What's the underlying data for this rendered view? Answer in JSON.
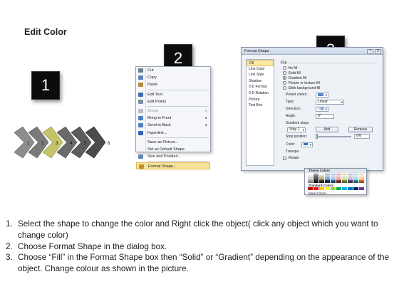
{
  "title": "Edit Color",
  "step_badges": [
    "1",
    "2",
    "3"
  ],
  "diagram": {
    "labels": [
      "1",
      "2",
      "3",
      "4",
      "5",
      "6"
    ],
    "colors": {
      "gray": "#8c8c8c",
      "selected": "#c6c46a",
      "dark": "#4c4c4c"
    }
  },
  "context_menu": {
    "items": [
      {
        "label": "Cut",
        "icon": "scissors-icon",
        "color": "#6b7c93",
        "state": "normal",
        "submenu": false
      },
      {
        "label": "Copy",
        "icon": "copy-icon",
        "color": "#5a83b8",
        "state": "normal",
        "submenu": false
      },
      {
        "label": "Paste",
        "icon": "paste-icon",
        "color": "#b8893a",
        "state": "normal",
        "submenu": false
      },
      {
        "label": "Edit Text",
        "icon": "edit-text-icon",
        "color": "#3d6fb0",
        "state": "normal",
        "submenu": false
      },
      {
        "label": "Edit Points",
        "icon": "edit-points-icon",
        "color": "#7a8ca3",
        "state": "normal",
        "submenu": false
      },
      {
        "label": "Group",
        "icon": "group-icon",
        "color": "#b8bec8",
        "state": "disabled",
        "submenu": true
      },
      {
        "label": "Bring to Front",
        "icon": "bring-to-front-icon",
        "color": "#4f7fc0",
        "state": "normal",
        "submenu": true
      },
      {
        "label": "Send to Back",
        "icon": "send-to-back-icon",
        "color": "#4f7fc0",
        "state": "normal",
        "submenu": true
      },
      {
        "label": "Hyperlink...",
        "icon": "hyperlink-icon",
        "color": "#2f66b3",
        "state": "normal",
        "submenu": false
      },
      {
        "label": "Save as Picture...",
        "icon": "",
        "color": "",
        "state": "normal",
        "submenu": false
      },
      {
        "label": "Set as Default Shape",
        "icon": "",
        "color": "",
        "state": "normal",
        "submenu": false
      },
      {
        "label": "Size and Position...",
        "icon": "size-position-icon",
        "color": "#5d87bd",
        "state": "normal",
        "submenu": false
      },
      {
        "label": "Format Shape...",
        "icon": "format-shape-icon",
        "color": "#c78a2e",
        "state": "highlight",
        "submenu": false
      }
    ]
  },
  "dialog": {
    "title": "Format Shape",
    "controls": [
      "?",
      "X"
    ],
    "nav": [
      "Fill",
      "Line Color",
      "Line Style",
      "Shadow",
      "3-D Format",
      "3-D Rotation",
      "Picture",
      "Text Box"
    ],
    "active_nav": "Fill",
    "section_title": "Fill",
    "fill_options": [
      {
        "label": "No fill",
        "selected": false
      },
      {
        "label": "Solid fill",
        "selected": false
      },
      {
        "label": "Gradient fill",
        "selected": true
      },
      {
        "label": "Picture or texture fill",
        "selected": false
      },
      {
        "label": "Slide background fill",
        "selected": false
      }
    ],
    "preset_label": "Preset colors:",
    "type_label": "Type:",
    "type_value": "Linear",
    "direction_label": "Direction:",
    "angle_label": "Angle:",
    "angle_value": "0°",
    "gradient_stops_label": "Gradient stops",
    "stop_value": "Stop 1",
    "add_label": "Add",
    "remove_label": "Remove",
    "stop_position_label": "Stop position:",
    "stop_position_value": "0%",
    "color_label": "Color:",
    "transparency_label": "Transpa",
    "rotate_label": "Rotate"
  },
  "palette": {
    "theme_title": "Theme Colors",
    "standard_title": "Standard Colors",
    "more_label": "More Colors...",
    "theme_rows": [
      [
        "#ffffff",
        "#000000",
        "#eeece1",
        "#1f497d",
        "#4f81bd",
        "#c0504d",
        "#9bbb59",
        "#8064a2",
        "#4bacc6",
        "#f79646"
      ],
      [
        "#f2f2f2",
        "#7f7f7f",
        "#ddd9c3",
        "#c6d9f0",
        "#dbe5f1",
        "#f2dcdb",
        "#ebf1dd",
        "#e5e0ec",
        "#dbeef3",
        "#fdeada"
      ],
      [
        "#d8d8d8",
        "#595959",
        "#c4bd97",
        "#8db3e2",
        "#b8cce4",
        "#e5b9b7",
        "#d7e3bc",
        "#ccc1d9",
        "#b7dde8",
        "#fbd5b5"
      ],
      [
        "#bfbfbf",
        "#3f3f3f",
        "#938953",
        "#548dd4",
        "#95b3d7",
        "#d99694",
        "#c3d69b",
        "#b2a2c7",
        "#92cddc",
        "#fac08f"
      ],
      [
        "#a5a5a5",
        "#262626",
        "#494429",
        "#17365d",
        "#366092",
        "#953734",
        "#76923c",
        "#5f497a",
        "#31859b",
        "#e36c09"
      ],
      [
        "#7f7f7f",
        "#0c0c0c",
        "#1d1b10",
        "#0f243e",
        "#244061",
        "#632423",
        "#4f6128",
        "#3f3151",
        "#205867",
        "#974806"
      ]
    ],
    "standard": [
      "#c00000",
      "#ff0000",
      "#ffc000",
      "#ffff00",
      "#92d050",
      "#00b050",
      "#00b0f0",
      "#0070c0",
      "#002060",
      "#7030a0"
    ]
  },
  "steps": [
    {
      "n": "1.",
      "text": "Select the shape to change the color and Right click the object( click any object which you want to change color)"
    },
    {
      "n": "2.",
      "text": "Choose Format Shape in the dialog box."
    },
    {
      "n": "3.",
      "text": "Choose “Fill” in the Format Shape box then “Solid” or “Gradient” depending on the appearance of the object. Change colour as shown in the picture."
    }
  ]
}
